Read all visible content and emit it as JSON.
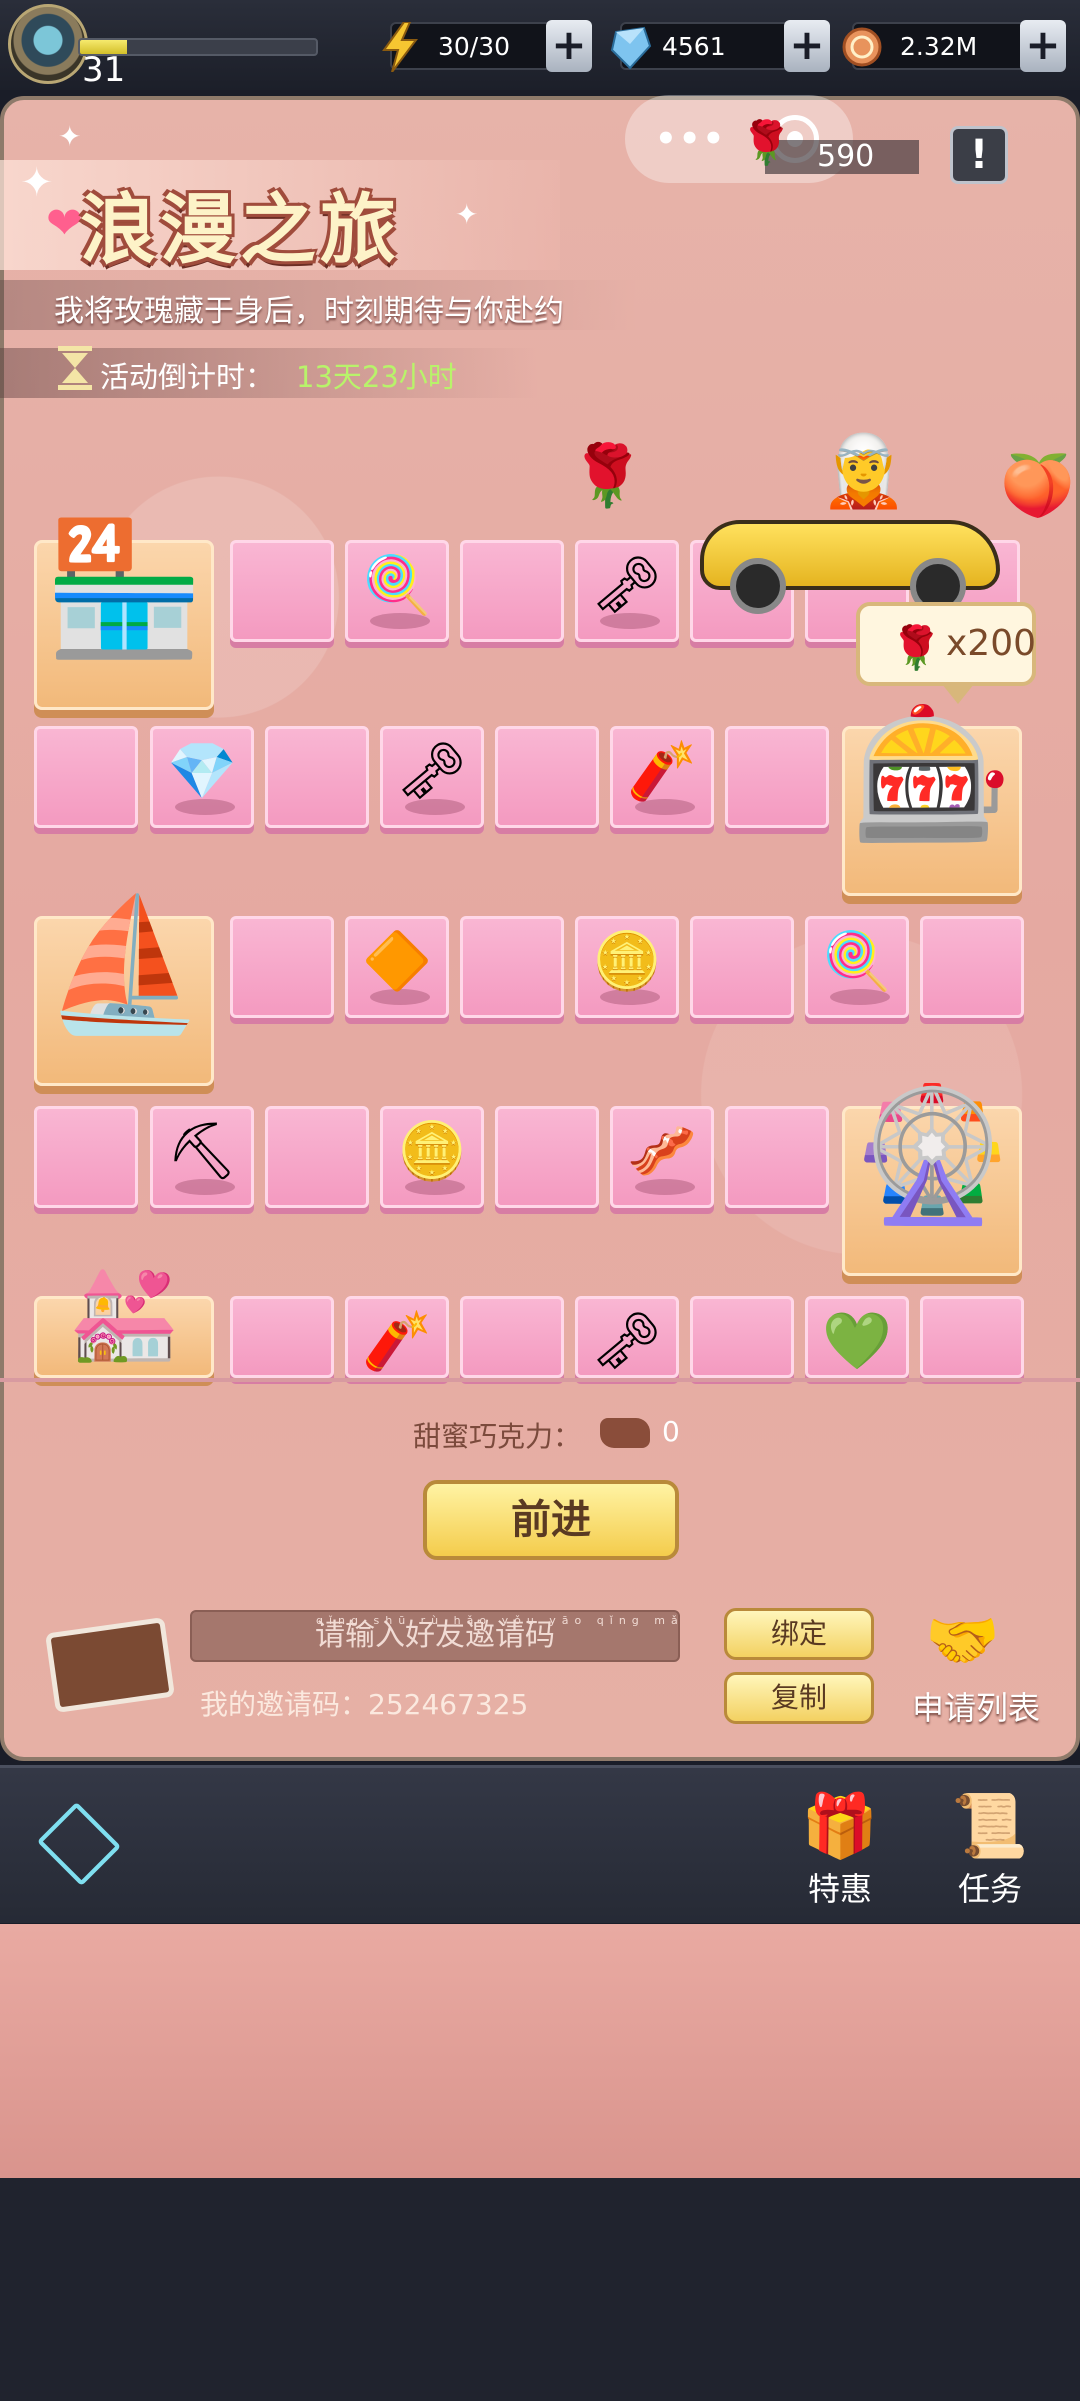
{
  "status_bar": {
    "level": "31",
    "xp_progress": 0.2,
    "energy": "30/30",
    "diamonds": "4561",
    "coins": "2.32M"
  },
  "panel": {
    "rose_count": "590",
    "title": "浪漫之旅",
    "subtitle": "我将玫瑰藏于身后，时刻期待与你赴约",
    "countdown_label": "活动倒计时：",
    "countdown_value": "13天23小时",
    "reward_bubble": "x200",
    "chocolate_label": "甜蜜巧克力：",
    "chocolate_value": "0",
    "go_button": "前进",
    "invite_placeholder": "请输入好友邀请码",
    "invite_pinyin": "qǐng shū rù hǎo yǒu yāo qǐng mǎ",
    "my_code_label": "我的邀请码：",
    "my_code_value": "252467325",
    "bind_button": "绑定",
    "copy_button": "复制",
    "apply_list": "申请列表"
  },
  "bottom_nav": {
    "special_offer": "特惠",
    "tasks": "任务"
  }
}
